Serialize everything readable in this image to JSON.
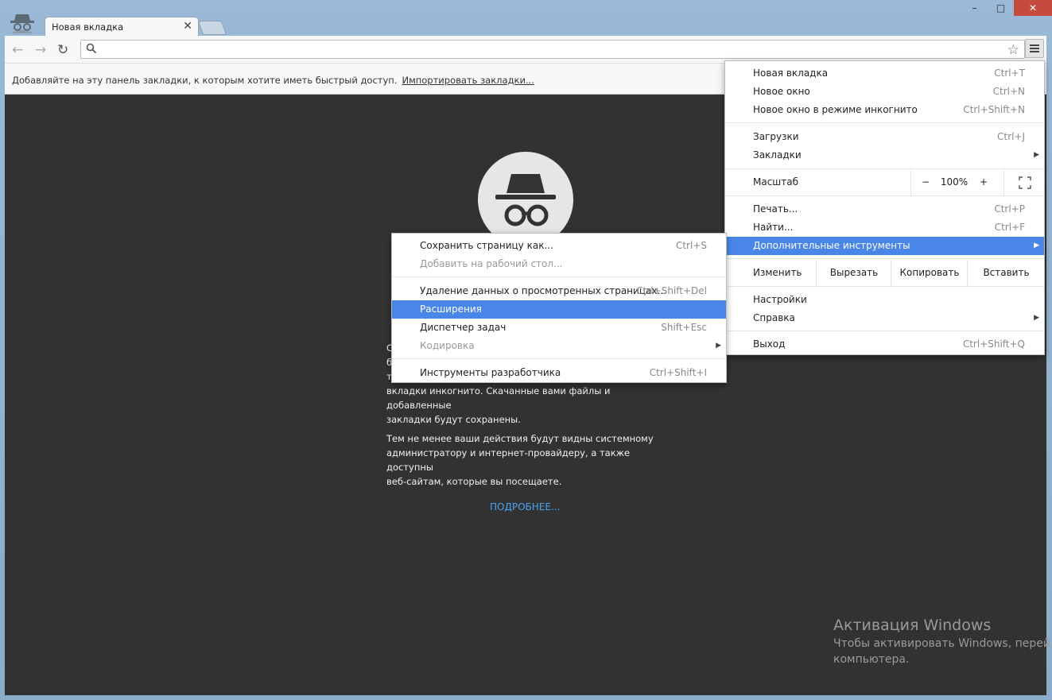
{
  "window": {
    "minimize_icon": "minimize-icon",
    "maximize_icon": "maximize-icon",
    "close_icon": "close-icon"
  },
  "tab": {
    "title": "Новая вкладка",
    "close": "✕"
  },
  "bookmarks_bar": {
    "text": "Добавляйте на эту панель закладки, к которым хотите иметь быстрый доступ.",
    "import_link": "Импортировать закладки..."
  },
  "incognito_page": {
    "para1_line1": "С",
    "para1_line2": "б",
    "para1_line3": "т",
    "para1_line4": "вкладки инкогнито. Скачанные вами файлы и добавленные",
    "para1_line5": "закладки будут сохранены.",
    "para2_line1": "Тем не менее ваши действия будут видны системному",
    "para2_line2": "администратору и интернет-провайдеру, а также доступны",
    "para2_line3": "веб-сайтам, которые вы посещаете.",
    "more_link": "ПОДРОБНЕЕ..."
  },
  "watermark": {
    "title": "Активация Windows",
    "line1": "Чтобы активировать Windows, перейд",
    "line2": "компьютера."
  },
  "main_menu": {
    "new_tab": {
      "label": "Новая вкладка",
      "shortcut": "Ctrl+T"
    },
    "new_window": {
      "label": "Новое окно",
      "shortcut": "Ctrl+N"
    },
    "incognito": {
      "label": "Новое окно в режиме инкогнито",
      "shortcut": "Ctrl+Shift+N"
    },
    "downloads": {
      "label": "Загрузки",
      "shortcut": "Ctrl+J"
    },
    "bookmarks": {
      "label": "Закладки"
    },
    "zoom": {
      "label": "Масштаб",
      "minus": "−",
      "value": "100%",
      "plus": "+"
    },
    "print": {
      "label": "Печать...",
      "shortcut": "Ctrl+P"
    },
    "find": {
      "label": "Найти...",
      "shortcut": "Ctrl+F"
    },
    "more_tools": {
      "label": "Дополнительные инструменты"
    },
    "edit": {
      "label": "Изменить",
      "cut": "Вырезать",
      "copy": "Копировать",
      "paste": "Вставить"
    },
    "settings": {
      "label": "Настройки"
    },
    "help": {
      "label": "Справка"
    },
    "exit": {
      "label": "Выход",
      "shortcut": "Ctrl+Shift+Q"
    }
  },
  "sub_menu": {
    "save_page": {
      "label": "Сохранить страницу как...",
      "shortcut": "Ctrl+S"
    },
    "add_to_desktop": {
      "label": "Добавить на рабочий стол..."
    },
    "clear_data": {
      "label": "Удаление данных о просмотренных страницах...",
      "shortcut": "Ctrl+Shift+Del"
    },
    "extensions": {
      "label": "Расширения"
    },
    "task_manager": {
      "label": "Диспетчер задач",
      "shortcut": "Shift+Esc"
    },
    "encoding": {
      "label": "Кодировка"
    },
    "dev_tools": {
      "label": "Инструменты разработчика",
      "shortcut": "Ctrl+Shift+I"
    }
  },
  "colors": {
    "highlight": "#4a86e8",
    "content_bg": "#323232",
    "link": "#4aa3f0"
  }
}
